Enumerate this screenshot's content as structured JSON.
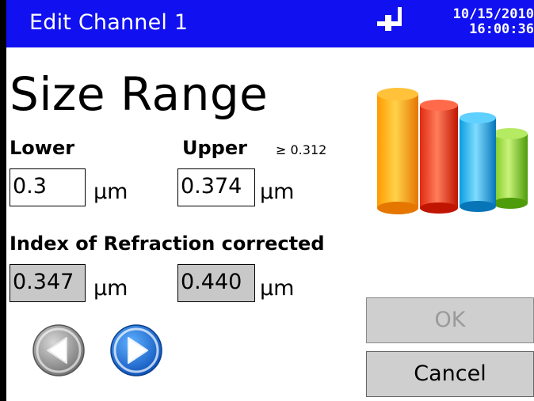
{
  "header": {
    "title": "Edit Channel 1",
    "date": "10/15/2010",
    "time": "16:00:36",
    "plug_icon": "power-plug-icon"
  },
  "main": {
    "heading": "Size Range",
    "lower_label": "Lower",
    "upper_label": "Upper",
    "upper_min": "≥ 0.312",
    "lower_value": "0.3",
    "upper_value": "0.374",
    "unit": "μm",
    "ior_label": "Index of Refraction corrected",
    "ior_lower_value": "0.347",
    "ior_upper_value": "0.440"
  },
  "nav": {
    "prev_icon": "arrow-left-icon",
    "next_icon": "arrow-right-icon"
  },
  "buttons": {
    "ok_label": "OK",
    "cancel_label": "Cancel"
  },
  "colors": {
    "titlebar": "#1010f0",
    "readonly_field": "#c8c8c8",
    "button_face": "#cfcfcf"
  }
}
